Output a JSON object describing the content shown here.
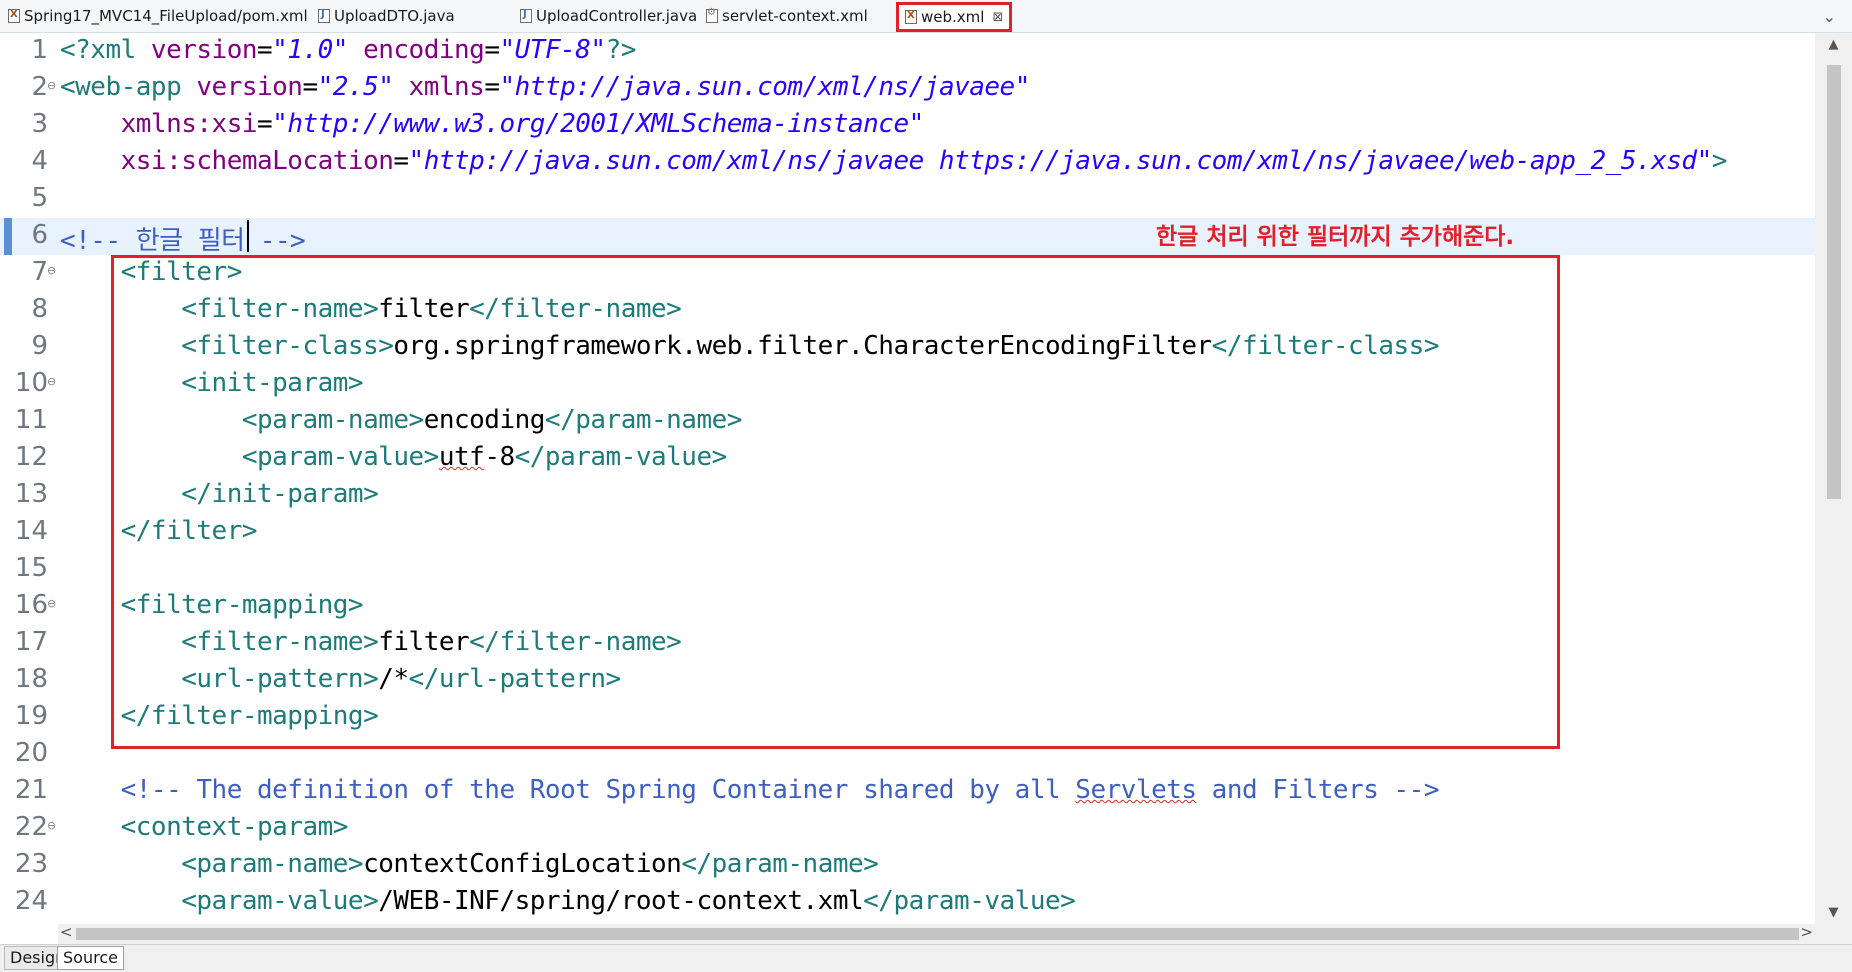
{
  "tabs": [
    {
      "label": "Spring17_MVC14_FileUpload/pom.xml",
      "icon": "xml-file-icon",
      "active": false
    },
    {
      "label": "UploadDTO.java",
      "icon": "java-file-icon",
      "active": false
    },
    {
      "label": "UploadController.java",
      "icon": "java-file-icon",
      "active": false
    },
    {
      "label": "servlet-context.xml",
      "icon": "config-file-icon",
      "active": false
    },
    {
      "label": "web.xml",
      "icon": "xml-file-icon",
      "active": true
    }
  ],
  "tab_close_glyph": "⊠",
  "tab_menu_glyph": "⌄",
  "annotation": {
    "text": "한글 처리 위한 필터까지 추가해준다.",
    "color": "#e0202a"
  },
  "current_line": 6,
  "lines": [
    {
      "n": "1",
      "fold": false,
      "tokens": [
        [
          "pi",
          "<?xml "
        ],
        [
          "attr",
          "version"
        ],
        [
          "txt",
          "="
        ],
        [
          "str",
          "\"1.0\""
        ],
        [
          "txt",
          " "
        ],
        [
          "attr",
          "encoding"
        ],
        [
          "txt",
          "="
        ],
        [
          "str",
          "\"UTF-8\""
        ],
        [
          "pi",
          "?>"
        ]
      ]
    },
    {
      "n": "2",
      "fold": true,
      "tokens": [
        [
          "tag",
          "<web-app "
        ],
        [
          "attr",
          "version"
        ],
        [
          "txt",
          "="
        ],
        [
          "str",
          "\"2.5\""
        ],
        [
          "txt",
          " "
        ],
        [
          "attr",
          "xmlns"
        ],
        [
          "txt",
          "="
        ],
        [
          "str",
          "\"http://java.sun.com/xml/ns/javaee\""
        ]
      ]
    },
    {
      "n": "3",
      "fold": false,
      "tokens": [
        [
          "txt",
          "    "
        ],
        [
          "attr",
          "xmlns:xsi"
        ],
        [
          "txt",
          "="
        ],
        [
          "str",
          "\"http://www.w3.org/2001/XMLSchema-instance\""
        ]
      ]
    },
    {
      "n": "4",
      "fold": false,
      "tokens": [
        [
          "txt",
          "    "
        ],
        [
          "attr",
          "xsi:schemaLocation"
        ],
        [
          "txt",
          "="
        ],
        [
          "str",
          "\"http://java.sun.com/xml/ns/javaee https://java.sun.com/xml/ns/javaee/web-app_2_5.xsd\""
        ],
        [
          "tag",
          ">"
        ]
      ]
    },
    {
      "n": "5",
      "fold": false,
      "tokens": []
    },
    {
      "n": "6",
      "fold": false,
      "tokens": [
        [
          "cmt",
          "<!-- 한글 필터 -->"
        ]
      ]
    },
    {
      "n": "7",
      "fold": true,
      "tokens": [
        [
          "txt",
          "    "
        ],
        [
          "tag",
          "<filter>"
        ]
      ]
    },
    {
      "n": "8",
      "fold": false,
      "tokens": [
        [
          "txt",
          "        "
        ],
        [
          "tag",
          "<filter-name>"
        ],
        [
          "txt",
          "filter"
        ],
        [
          "tag",
          "</filter-name>"
        ]
      ]
    },
    {
      "n": "9",
      "fold": false,
      "tokens": [
        [
          "txt",
          "        "
        ],
        [
          "tag",
          "<filter-class>"
        ],
        [
          "txt",
          "org.springframework.web.filter.CharacterEncodingFilter"
        ],
        [
          "tag",
          "</filter-class>"
        ]
      ]
    },
    {
      "n": "10",
      "fold": true,
      "tokens": [
        [
          "txt",
          "        "
        ],
        [
          "tag",
          "<init-param>"
        ]
      ]
    },
    {
      "n": "11",
      "fold": false,
      "tokens": [
        [
          "txt",
          "            "
        ],
        [
          "tag",
          "<param-name>"
        ],
        [
          "txt",
          "encoding"
        ],
        [
          "tag",
          "</param-name>"
        ]
      ]
    },
    {
      "n": "12",
      "fold": false,
      "tokens": [
        [
          "txt",
          "            "
        ],
        [
          "tag",
          "<param-value>"
        ],
        [
          "sq",
          "utf"
        ],
        [
          "txt",
          "-8"
        ],
        [
          "tag",
          "</param-value>"
        ]
      ]
    },
    {
      "n": "13",
      "fold": false,
      "tokens": [
        [
          "txt",
          "        "
        ],
        [
          "tag",
          "</init-param>"
        ]
      ]
    },
    {
      "n": "14",
      "fold": false,
      "tokens": [
        [
          "txt",
          "    "
        ],
        [
          "tag",
          "</filter>"
        ]
      ]
    },
    {
      "n": "15",
      "fold": false,
      "tokens": []
    },
    {
      "n": "16",
      "fold": true,
      "tokens": [
        [
          "txt",
          "    "
        ],
        [
          "tag",
          "<filter-mapping>"
        ]
      ]
    },
    {
      "n": "17",
      "fold": false,
      "tokens": [
        [
          "txt",
          "        "
        ],
        [
          "tag",
          "<filter-name>"
        ],
        [
          "txt",
          "filter"
        ],
        [
          "tag",
          "</filter-name>"
        ]
      ]
    },
    {
      "n": "18",
      "fold": false,
      "tokens": [
        [
          "txt",
          "        "
        ],
        [
          "tag",
          "<url-pattern>"
        ],
        [
          "txt",
          "/*"
        ],
        [
          "tag",
          "</url-pattern>"
        ]
      ]
    },
    {
      "n": "19",
      "fold": false,
      "tokens": [
        [
          "txt",
          "    "
        ],
        [
          "tag",
          "</filter-mapping>"
        ]
      ]
    },
    {
      "n": "20",
      "fold": false,
      "tokens": []
    },
    {
      "n": "21",
      "fold": false,
      "tokens": [
        [
          "txt",
          "    "
        ],
        [
          "cmt",
          "<!-- The definition of the Root Spring Container shared by all "
        ],
        [
          "cmtsq",
          "Servlets"
        ],
        [
          "cmt",
          " and Filters -->"
        ]
      ]
    },
    {
      "n": "22",
      "fold": true,
      "tokens": [
        [
          "txt",
          "    "
        ],
        [
          "tag",
          "<context-param>"
        ]
      ]
    },
    {
      "n": "23",
      "fold": false,
      "tokens": [
        [
          "txt",
          "        "
        ],
        [
          "tag",
          "<param-name>"
        ],
        [
          "txt",
          "contextConfigLocation"
        ],
        [
          "tag",
          "</param-name>"
        ]
      ]
    },
    {
      "n": "24",
      "fold": false,
      "tokens": [
        [
          "txt",
          "        "
        ],
        [
          "tag",
          "<param-value>"
        ],
        [
          "txt",
          "/WEB-INF/spring/root-context.xml"
        ],
        [
          "tag",
          "</param-value>"
        ]
      ]
    }
  ],
  "scroll": {
    "up_glyph": "▲",
    "down_glyph": "▼",
    "left_glyph": "<",
    "right_glyph": ">"
  },
  "bottom_tabs": [
    {
      "label": "Design",
      "active": false
    },
    {
      "label": "Source",
      "active": true
    }
  ],
  "colors": {
    "tag": "#1f7a7a",
    "attribute": "#7f007f",
    "string": "#2a00ff",
    "comment": "#3f5fbf",
    "highlight_box": "#e0202a",
    "current_line": "#e8f2fe"
  }
}
